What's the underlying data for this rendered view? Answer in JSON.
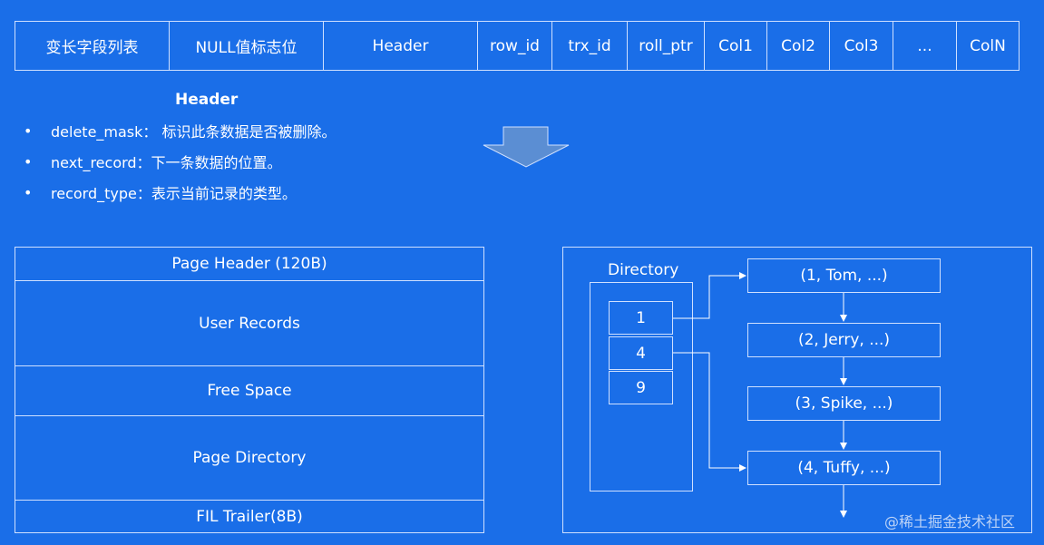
{
  "row_format": {
    "cells": [
      "变长字段列表",
      "NULL值标志位",
      "Header",
      "row_id",
      "trx_id",
      "roll_ptr",
      "Col1",
      "Col2",
      "Col3",
      "...",
      "ColN"
    ]
  },
  "header_section": {
    "title": "Header",
    "bullets": [
      "delete_mask： 标识此条数据是否被删除。",
      "next_record：下一条数据的位置。",
      "record_type：表示当前记录的类型。"
    ]
  },
  "page_structure": {
    "sections": [
      "Page Header (120B)",
      "User Records",
      "Free Space",
      "Page Directory",
      "FIL Trailer(8B)"
    ]
  },
  "directory_diagram": {
    "label": "Directory",
    "slots": [
      "1",
      "4",
      "9"
    ],
    "records": [
      "(1, Tom, ...)",
      "(2, Jerry, ...)",
      "(3, Spike, ...)",
      "(4, Tuffy, ...)"
    ]
  },
  "watermark": "@稀土掘金技术社区",
  "colors": {
    "background": "#1a6ee8",
    "line": "#cfe0ff",
    "text": "#ffffff"
  }
}
